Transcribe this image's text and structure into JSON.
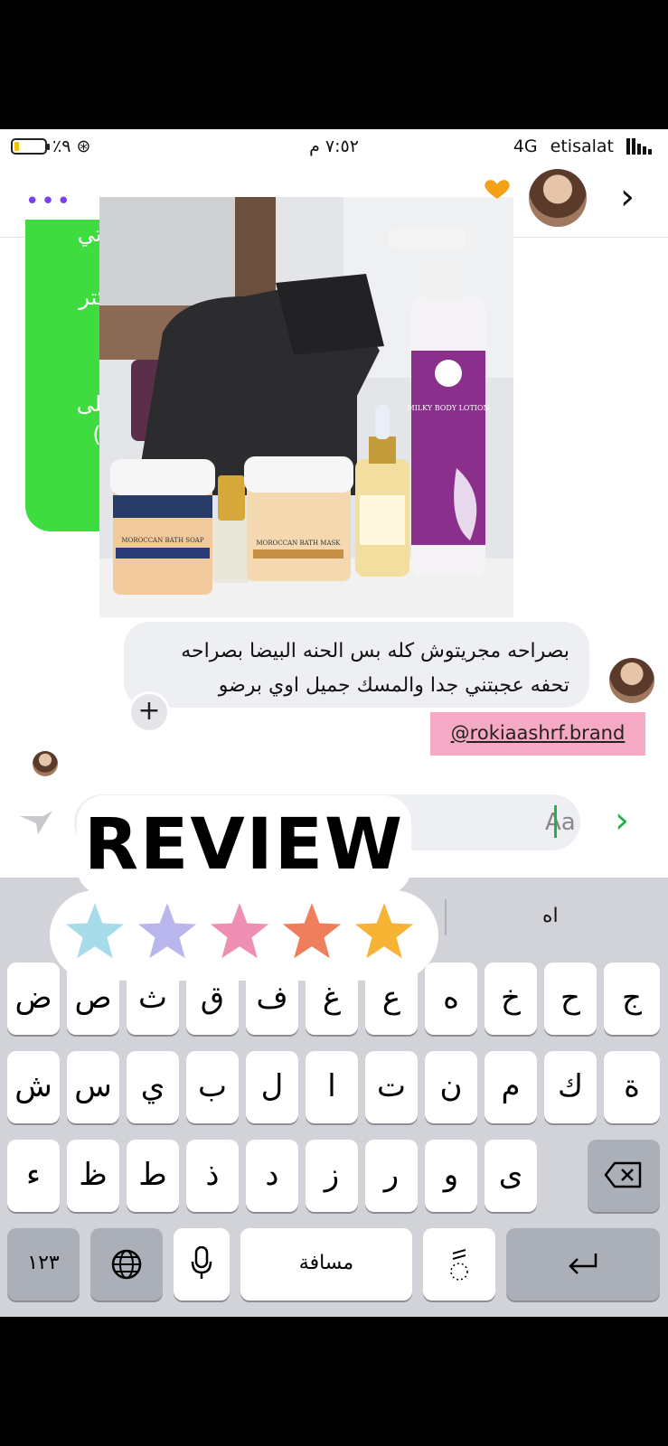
{
  "status_bar": {
    "battery": "٪٩",
    "time": "٧:٥٢ م",
    "network": "4G",
    "carrier": "etisalat"
  },
  "header": {
    "more_icon": "three-dots-icon",
    "back_icon": "chevron-right-icon"
  },
  "chat": {
    "green_partial_lines": [
      "التي",
      "كتر،",
      "على",
      "(.."
    ],
    "product_photo_labels": {
      "soap": "MOROCCAN BATH SOAP",
      "mask": "MOROCCAN BATH MASK",
      "lotion": "MILKY BODY LOTION"
    },
    "message_line_1": "بصراحه مجريتوش كله بس الحنه البيضا بصراحه",
    "message_line_2": "تحفه عجبتني جدا والمسك جميل اوي برضو",
    "brand_tag": "@rokiaashrf.brand",
    "add_reaction": "+"
  },
  "input": {
    "placeholder": "Aa"
  },
  "keyboard": {
    "suggestion": "اه",
    "row1": [
      "ض",
      "ص",
      "ث",
      "ق",
      "ف",
      "غ",
      "ع",
      "ه",
      "خ",
      "ح",
      "ج"
    ],
    "row2": [
      "ش",
      "س",
      "ي",
      "ب",
      "ل",
      "ا",
      "ت",
      "ن",
      "م",
      "ك",
      "ة"
    ],
    "row3": [
      "ء",
      "ظ",
      "ط",
      "ذ",
      "د",
      "ز",
      "ر",
      "و",
      "ى"
    ],
    "numbers_key": "١٢٣",
    "space_key": "مسافة"
  },
  "sticker": {
    "text": "REVIEW",
    "stars": [
      "#a6dbe9",
      "#b9b6ee",
      "#ef8eb3",
      "#ee7e5c",
      "#f7b434"
    ]
  }
}
